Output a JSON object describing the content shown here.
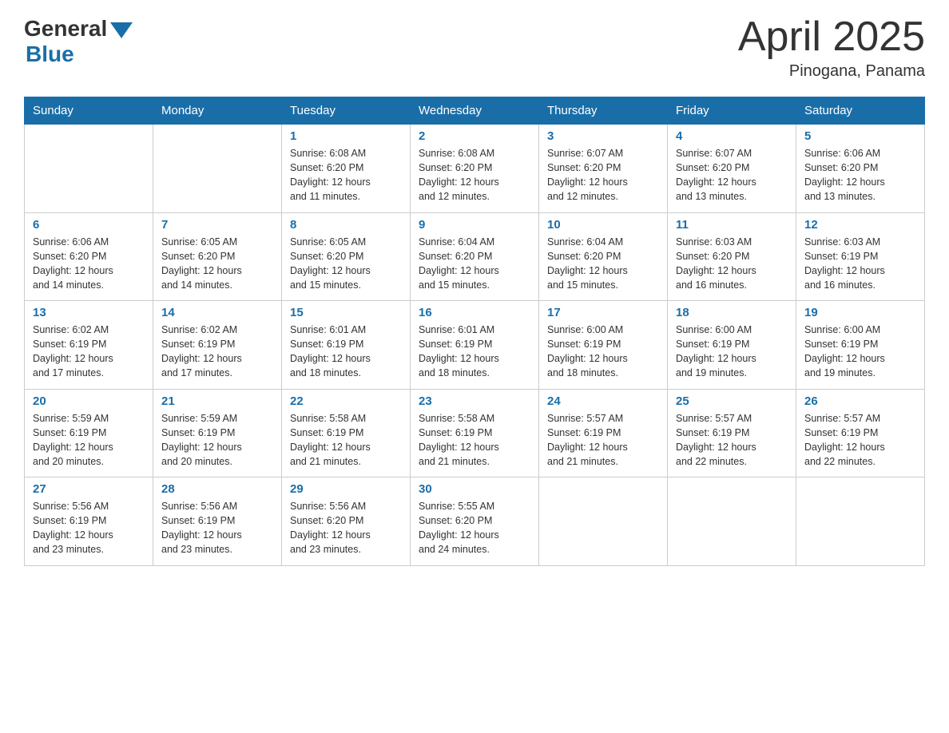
{
  "logo": {
    "general": "General",
    "blue": "Blue"
  },
  "title": "April 2025",
  "location": "Pinogana, Panama",
  "days_of_week": [
    "Sunday",
    "Monday",
    "Tuesday",
    "Wednesday",
    "Thursday",
    "Friday",
    "Saturday"
  ],
  "weeks": [
    [
      {
        "day": "",
        "info": ""
      },
      {
        "day": "",
        "info": ""
      },
      {
        "day": "1",
        "info": "Sunrise: 6:08 AM\nSunset: 6:20 PM\nDaylight: 12 hours\nand 11 minutes."
      },
      {
        "day": "2",
        "info": "Sunrise: 6:08 AM\nSunset: 6:20 PM\nDaylight: 12 hours\nand 12 minutes."
      },
      {
        "day": "3",
        "info": "Sunrise: 6:07 AM\nSunset: 6:20 PM\nDaylight: 12 hours\nand 12 minutes."
      },
      {
        "day": "4",
        "info": "Sunrise: 6:07 AM\nSunset: 6:20 PM\nDaylight: 12 hours\nand 13 minutes."
      },
      {
        "day": "5",
        "info": "Sunrise: 6:06 AM\nSunset: 6:20 PM\nDaylight: 12 hours\nand 13 minutes."
      }
    ],
    [
      {
        "day": "6",
        "info": "Sunrise: 6:06 AM\nSunset: 6:20 PM\nDaylight: 12 hours\nand 14 minutes."
      },
      {
        "day": "7",
        "info": "Sunrise: 6:05 AM\nSunset: 6:20 PM\nDaylight: 12 hours\nand 14 minutes."
      },
      {
        "day": "8",
        "info": "Sunrise: 6:05 AM\nSunset: 6:20 PM\nDaylight: 12 hours\nand 15 minutes."
      },
      {
        "day": "9",
        "info": "Sunrise: 6:04 AM\nSunset: 6:20 PM\nDaylight: 12 hours\nand 15 minutes."
      },
      {
        "day": "10",
        "info": "Sunrise: 6:04 AM\nSunset: 6:20 PM\nDaylight: 12 hours\nand 15 minutes."
      },
      {
        "day": "11",
        "info": "Sunrise: 6:03 AM\nSunset: 6:20 PM\nDaylight: 12 hours\nand 16 minutes."
      },
      {
        "day": "12",
        "info": "Sunrise: 6:03 AM\nSunset: 6:19 PM\nDaylight: 12 hours\nand 16 minutes."
      }
    ],
    [
      {
        "day": "13",
        "info": "Sunrise: 6:02 AM\nSunset: 6:19 PM\nDaylight: 12 hours\nand 17 minutes."
      },
      {
        "day": "14",
        "info": "Sunrise: 6:02 AM\nSunset: 6:19 PM\nDaylight: 12 hours\nand 17 minutes."
      },
      {
        "day": "15",
        "info": "Sunrise: 6:01 AM\nSunset: 6:19 PM\nDaylight: 12 hours\nand 18 minutes."
      },
      {
        "day": "16",
        "info": "Sunrise: 6:01 AM\nSunset: 6:19 PM\nDaylight: 12 hours\nand 18 minutes."
      },
      {
        "day": "17",
        "info": "Sunrise: 6:00 AM\nSunset: 6:19 PM\nDaylight: 12 hours\nand 18 minutes."
      },
      {
        "day": "18",
        "info": "Sunrise: 6:00 AM\nSunset: 6:19 PM\nDaylight: 12 hours\nand 19 minutes."
      },
      {
        "day": "19",
        "info": "Sunrise: 6:00 AM\nSunset: 6:19 PM\nDaylight: 12 hours\nand 19 minutes."
      }
    ],
    [
      {
        "day": "20",
        "info": "Sunrise: 5:59 AM\nSunset: 6:19 PM\nDaylight: 12 hours\nand 20 minutes."
      },
      {
        "day": "21",
        "info": "Sunrise: 5:59 AM\nSunset: 6:19 PM\nDaylight: 12 hours\nand 20 minutes."
      },
      {
        "day": "22",
        "info": "Sunrise: 5:58 AM\nSunset: 6:19 PM\nDaylight: 12 hours\nand 21 minutes."
      },
      {
        "day": "23",
        "info": "Sunrise: 5:58 AM\nSunset: 6:19 PM\nDaylight: 12 hours\nand 21 minutes."
      },
      {
        "day": "24",
        "info": "Sunrise: 5:57 AM\nSunset: 6:19 PM\nDaylight: 12 hours\nand 21 minutes."
      },
      {
        "day": "25",
        "info": "Sunrise: 5:57 AM\nSunset: 6:19 PM\nDaylight: 12 hours\nand 22 minutes."
      },
      {
        "day": "26",
        "info": "Sunrise: 5:57 AM\nSunset: 6:19 PM\nDaylight: 12 hours\nand 22 minutes."
      }
    ],
    [
      {
        "day": "27",
        "info": "Sunrise: 5:56 AM\nSunset: 6:19 PM\nDaylight: 12 hours\nand 23 minutes."
      },
      {
        "day": "28",
        "info": "Sunrise: 5:56 AM\nSunset: 6:19 PM\nDaylight: 12 hours\nand 23 minutes."
      },
      {
        "day": "29",
        "info": "Sunrise: 5:56 AM\nSunset: 6:20 PM\nDaylight: 12 hours\nand 23 minutes."
      },
      {
        "day": "30",
        "info": "Sunrise: 5:55 AM\nSunset: 6:20 PM\nDaylight: 12 hours\nand 24 minutes."
      },
      {
        "day": "",
        "info": ""
      },
      {
        "day": "",
        "info": ""
      },
      {
        "day": "",
        "info": ""
      }
    ]
  ]
}
